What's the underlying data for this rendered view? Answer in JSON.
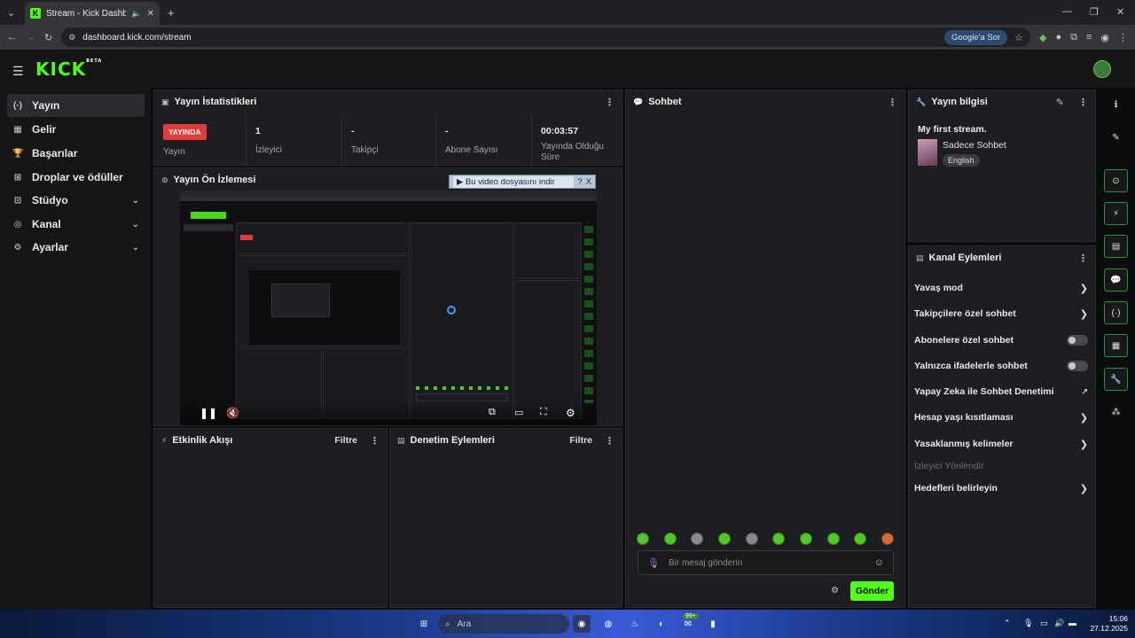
{
  "browser": {
    "tab_title": "Stream - Kick Dashboard",
    "url": "dashboard.kick.com/stream",
    "google_sor": "Google'a Sor"
  },
  "app": {
    "logo": "KICK",
    "logo_badge": "BETA"
  },
  "sidebar": {
    "items": [
      {
        "label": "Yayın",
        "icon": "broadcast-icon"
      },
      {
        "label": "Gelir",
        "icon": "revenue-icon"
      },
      {
        "label": "Başarılar",
        "icon": "trophy-icon"
      },
      {
        "label": "Droplar ve ödüller",
        "icon": "gift-icon"
      },
      {
        "label": "Stüdyo",
        "icon": "studio-icon"
      },
      {
        "label": "Kanal",
        "icon": "channel-icon"
      },
      {
        "label": "Ayarlar",
        "icon": "settings-icon"
      }
    ]
  },
  "stats": {
    "title": "Yayın İstatistikleri",
    "live_badge": "YAYINDA",
    "live_label": "Yayın",
    "viewers_value": "1",
    "viewers_label": "İzleyici",
    "followers_value": "-",
    "followers_label": "Takipçi",
    "subs_value": "-",
    "subs_label": "Abone Sayısı",
    "uptime_value": "00:03:57",
    "uptime_label": "Yayında Olduğu Süre"
  },
  "preview": {
    "title": "Yayın Ön İzlemesi",
    "download_bar": "Bu video dosyasını indir",
    "download_help": "?",
    "download_close": "X"
  },
  "activity": {
    "title": "Etkinlik Akışı",
    "filter": "Filtre"
  },
  "moderation": {
    "title": "Denetim Eylemleri",
    "filter": "Filtre"
  },
  "chat": {
    "title": "Sohbet",
    "placeholder": "Bir mesaj gönderin",
    "send": "Gönder"
  },
  "stream_info": {
    "title": "Yayın bilgisi",
    "stream_title": "My first stream.",
    "category": "Sadece Sohbet",
    "language": "English"
  },
  "channel_actions": {
    "title": "Kanal Eylemleri",
    "items": [
      {
        "label": "Yavaş mod",
        "control": "chevron"
      },
      {
        "label": "Takipçilere özel sohbet",
        "control": "chevron"
      },
      {
        "label": "Abonelere özel sohbet",
        "control": "toggle",
        "value": false
      },
      {
        "label": "Yalnızca ifadelerle sohbet",
        "control": "toggle",
        "value": false
      },
      {
        "label": "Yapay Zeka ile Sohbet Denetimi",
        "control": "external"
      },
      {
        "label": "Hesap yaşı kısıtlaması",
        "control": "chevron"
      },
      {
        "label": "Yasaklanmış kelimeler",
        "control": "chevron"
      },
      {
        "label": "İzleyici Yönlendir",
        "control": "none",
        "disabled": true
      },
      {
        "label": "Hedefleri belirleyin",
        "control": "chevron"
      }
    ]
  },
  "taskbar": {
    "search_placeholder": "Ara",
    "time": "15:06",
    "date": "27.12.2025",
    "badge": "99+"
  },
  "colors": {
    "accent": "#53fc18",
    "live": "#e33a3a",
    "panel": "#1d1e21"
  }
}
